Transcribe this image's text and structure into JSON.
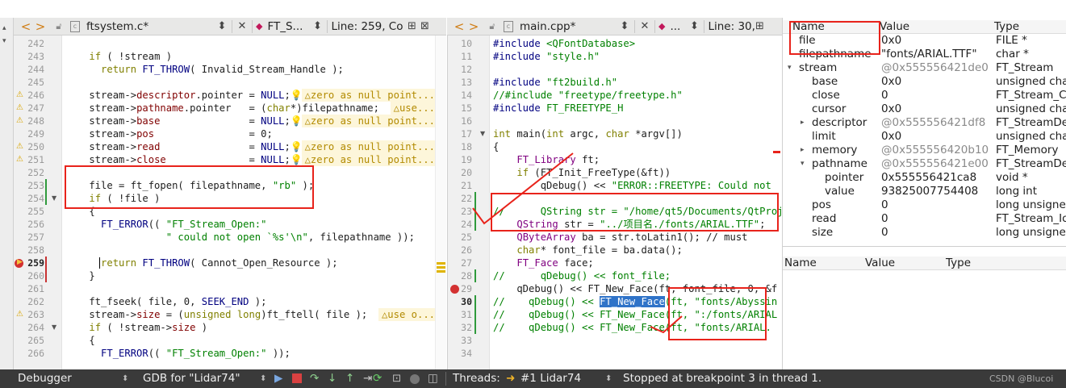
{
  "left_editor": {
    "toolbar": {
      "back": "<",
      "forward": ">",
      "filename": "ftsystem.c*",
      "symbol": "FT_S...",
      "position": "Line: 259, Co"
    },
    "lines": [
      {
        "n": "242",
        "text": ""
      },
      {
        "n": "243",
        "text": "    if ( !stream )"
      },
      {
        "n": "244",
        "text": "      return FT_THROW( Invalid_Stream_Handle );"
      },
      {
        "n": "245",
        "text": ""
      },
      {
        "n": "246",
        "text": "    stream->descriptor.pointer = NULL;💡",
        "warn": "△zero as null point..."
      },
      {
        "n": "247",
        "text": "    stream->pathname.pointer   = (char*)filepathname;",
        "warn": "△use..."
      },
      {
        "n": "248",
        "text": "    stream->base               = NULL;💡",
        "warn": "△zero as null point..."
      },
      {
        "n": "249",
        "text": "    stream->pos                = 0;"
      },
      {
        "n": "250",
        "text": "    stream->read               = NULL;💡",
        "warn": "△zero as null point..."
      },
      {
        "n": "251",
        "text": "    stream->close              = NULL;💡",
        "warn": "△zero as null point..."
      },
      {
        "n": "252",
        "text": ""
      },
      {
        "n": "253",
        "text": "    file = ft_fopen( filepathname, \"rb\" );"
      },
      {
        "n": "254",
        "text": "    if ( !file )"
      },
      {
        "n": "255",
        "text": "    {"
      },
      {
        "n": "256",
        "text": "      FT_ERROR(( \"FT_Stream_Open:\""
      },
      {
        "n": "257",
        "text": "                 \" could not open `%s'\\n\", filepathname ));"
      },
      {
        "n": "258",
        "text": ""
      },
      {
        "n": "259",
        "text": "      return FT_THROW( Cannot_Open_Resource );"
      },
      {
        "n": "260",
        "text": "    }"
      },
      {
        "n": "261",
        "text": ""
      },
      {
        "n": "262",
        "text": "    ft_fseek( file, 0, SEEK_END );"
      },
      {
        "n": "263",
        "text": "    stream->size = (unsigned long)ft_ftell( file );",
        "warn": "△use o..."
      },
      {
        "n": "264",
        "text": "    if ( !stream->size )"
      },
      {
        "n": "265",
        "text": "    {"
      },
      {
        "n": "266",
        "text": "      FT_ERROR(( \"FT_Stream_Open:\" ));"
      }
    ]
  },
  "right_editor": {
    "toolbar": {
      "back": "<",
      "forward": ">",
      "filename": "main.cpp*",
      "symbol": "...",
      "position": "Line: 30,"
    },
    "lines": [
      {
        "n": "10",
        "text": "#include <QFontDatabase>"
      },
      {
        "n": "11",
        "text": "#include \"style.h\""
      },
      {
        "n": "12",
        "text": ""
      },
      {
        "n": "13",
        "text": "#include \"ft2build.h\""
      },
      {
        "n": "14",
        "text": "//#include \"freetype/freetype.h\""
      },
      {
        "n": "15",
        "text": "#include FT_FREETYPE_H"
      },
      {
        "n": "16",
        "text": ""
      },
      {
        "n": "17",
        "text": "int main(int argc, char *argv[])"
      },
      {
        "n": "18",
        "text": "{"
      },
      {
        "n": "19",
        "text": "    FT_Library ft;"
      },
      {
        "n": "20",
        "text": "    if (FT_Init_FreeType(&ft))"
      },
      {
        "n": "21",
        "text": "        qDebug() << \"ERROR::FREETYPE: Could not"
      },
      {
        "n": "22",
        "text": ""
      },
      {
        "n": "23",
        "text": "//      QString str = \"/home/qt5/Documents/QtProje"
      },
      {
        "n": "24",
        "text": "    QString str = \"../项目名./fonts/ARIAL.TTF\";"
      },
      {
        "n": "25",
        "text": "    QByteArray ba = str.toLatin1(); // must"
      },
      {
        "n": "26",
        "text": "    char* font_file = ba.data();"
      },
      {
        "n": "27",
        "text": "    FT_Face face;"
      },
      {
        "n": "28",
        "text": "//      qDebug() << font_file;"
      },
      {
        "n": "29",
        "text": "    qDebug() << FT_New_Face(ft, font_file, 0, &f"
      },
      {
        "n": "30",
        "text": "//    qDebug() << FT_New_Face(ft, \"fonts/Abyssin"
      },
      {
        "n": "31",
        "text": "//    qDebug() << FT_New_Face(ft, \":/fonts/ARIAL"
      },
      {
        "n": "32",
        "text": "//    qDebug() << FT_New_Face(ft, \"fonts/ARIAL."
      },
      {
        "n": "33",
        "text": ""
      },
      {
        "n": "34",
        "text": ""
      }
    ]
  },
  "locals": {
    "headers": {
      "name": "Name",
      "value": "Value",
      "type": "Type"
    },
    "rows": [
      {
        "name": "file",
        "value": "0x0",
        "type": "FILE *",
        "indent": 0,
        "arrow": ""
      },
      {
        "name": "filepathname",
        "value": "\"fonts/ARIAL.TTF\"",
        "type": "char *",
        "indent": 0,
        "arrow": ""
      },
      {
        "name": "stream",
        "value": "@0x555556421de0",
        "type": "FT_Stream",
        "indent": 0,
        "arrow": "▾",
        "addr": true
      },
      {
        "name": "base",
        "value": "0x0",
        "type": "unsigned cha",
        "indent": 1,
        "arrow": ""
      },
      {
        "name": "close",
        "value": "0",
        "type": "FT_Stream_C",
        "indent": 1,
        "arrow": ""
      },
      {
        "name": "cursor",
        "value": "0x0",
        "type": "unsigned cha",
        "indent": 1,
        "arrow": ""
      },
      {
        "name": "descriptor",
        "value": "@0x555556421df8",
        "type": "FT_StreamDe",
        "indent": 1,
        "arrow": "▸",
        "addr": true
      },
      {
        "name": "limit",
        "value": "0x0",
        "type": "unsigned cha",
        "indent": 1,
        "arrow": ""
      },
      {
        "name": "memory",
        "value": "@0x555556420b10",
        "type": "FT_Memory",
        "indent": 1,
        "arrow": "▸",
        "addr": true
      },
      {
        "name": "pathname",
        "value": "@0x555556421e00",
        "type": "FT_StreamDe",
        "indent": 1,
        "arrow": "▾",
        "addr": true
      },
      {
        "name": "pointer",
        "value": "0x555556421ca8",
        "type": "void *",
        "indent": 2,
        "arrow": ""
      },
      {
        "name": "value",
        "value": "93825007754408",
        "type": "long int",
        "indent": 2,
        "arrow": ""
      },
      {
        "name": "pos",
        "value": "0",
        "type": "long unsigne",
        "indent": 1,
        "arrow": ""
      },
      {
        "name": "read",
        "value": "0",
        "type": "FT_Stream_Io",
        "indent": 1,
        "arrow": ""
      },
      {
        "name": "size",
        "value": "0",
        "type": "long unsigne",
        "indent": 1,
        "arrow": ""
      }
    ]
  },
  "watches": {
    "headers": {
      "name": "Name",
      "value": "Value",
      "type": "Type"
    }
  },
  "statusbar": {
    "mode": "Debugger",
    "engine": "GDB for \"Lidar74\"",
    "threads_label": "Threads:",
    "thread": "#1 Lidar74",
    "status": "Stopped at breakpoint 3 in thread 1.",
    "watermark": "CSDN @Blucoi"
  },
  "colors": {
    "annotation_red": "#e8231b",
    "selection_blue": "#2f73c8",
    "breakpoint": "#d33131"
  }
}
